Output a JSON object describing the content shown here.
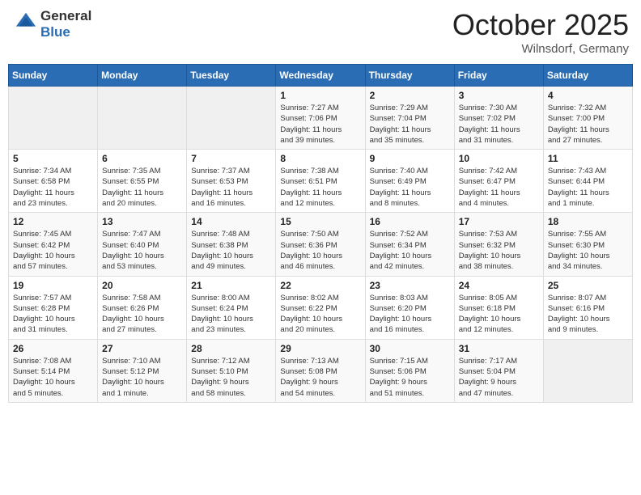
{
  "header": {
    "logo_line1": "General",
    "logo_line2": "Blue",
    "month_title": "October 2025",
    "location": "Wilnsdorf, Germany"
  },
  "days_of_week": [
    "Sunday",
    "Monday",
    "Tuesday",
    "Wednesday",
    "Thursday",
    "Friday",
    "Saturday"
  ],
  "weeks": [
    [
      {
        "day": "",
        "info": ""
      },
      {
        "day": "",
        "info": ""
      },
      {
        "day": "",
        "info": ""
      },
      {
        "day": "1",
        "info": "Sunrise: 7:27 AM\nSunset: 7:06 PM\nDaylight: 11 hours\nand 39 minutes."
      },
      {
        "day": "2",
        "info": "Sunrise: 7:29 AM\nSunset: 7:04 PM\nDaylight: 11 hours\nand 35 minutes."
      },
      {
        "day": "3",
        "info": "Sunrise: 7:30 AM\nSunset: 7:02 PM\nDaylight: 11 hours\nand 31 minutes."
      },
      {
        "day": "4",
        "info": "Sunrise: 7:32 AM\nSunset: 7:00 PM\nDaylight: 11 hours\nand 27 minutes."
      }
    ],
    [
      {
        "day": "5",
        "info": "Sunrise: 7:34 AM\nSunset: 6:58 PM\nDaylight: 11 hours\nand 23 minutes."
      },
      {
        "day": "6",
        "info": "Sunrise: 7:35 AM\nSunset: 6:55 PM\nDaylight: 11 hours\nand 20 minutes."
      },
      {
        "day": "7",
        "info": "Sunrise: 7:37 AM\nSunset: 6:53 PM\nDaylight: 11 hours\nand 16 minutes."
      },
      {
        "day": "8",
        "info": "Sunrise: 7:38 AM\nSunset: 6:51 PM\nDaylight: 11 hours\nand 12 minutes."
      },
      {
        "day": "9",
        "info": "Sunrise: 7:40 AM\nSunset: 6:49 PM\nDaylight: 11 hours\nand 8 minutes."
      },
      {
        "day": "10",
        "info": "Sunrise: 7:42 AM\nSunset: 6:47 PM\nDaylight: 11 hours\nand 4 minutes."
      },
      {
        "day": "11",
        "info": "Sunrise: 7:43 AM\nSunset: 6:44 PM\nDaylight: 11 hours\nand 1 minute."
      }
    ],
    [
      {
        "day": "12",
        "info": "Sunrise: 7:45 AM\nSunset: 6:42 PM\nDaylight: 10 hours\nand 57 minutes."
      },
      {
        "day": "13",
        "info": "Sunrise: 7:47 AM\nSunset: 6:40 PM\nDaylight: 10 hours\nand 53 minutes."
      },
      {
        "day": "14",
        "info": "Sunrise: 7:48 AM\nSunset: 6:38 PM\nDaylight: 10 hours\nand 49 minutes."
      },
      {
        "day": "15",
        "info": "Sunrise: 7:50 AM\nSunset: 6:36 PM\nDaylight: 10 hours\nand 46 minutes."
      },
      {
        "day": "16",
        "info": "Sunrise: 7:52 AM\nSunset: 6:34 PM\nDaylight: 10 hours\nand 42 minutes."
      },
      {
        "day": "17",
        "info": "Sunrise: 7:53 AM\nSunset: 6:32 PM\nDaylight: 10 hours\nand 38 minutes."
      },
      {
        "day": "18",
        "info": "Sunrise: 7:55 AM\nSunset: 6:30 PM\nDaylight: 10 hours\nand 34 minutes."
      }
    ],
    [
      {
        "day": "19",
        "info": "Sunrise: 7:57 AM\nSunset: 6:28 PM\nDaylight: 10 hours\nand 31 minutes."
      },
      {
        "day": "20",
        "info": "Sunrise: 7:58 AM\nSunset: 6:26 PM\nDaylight: 10 hours\nand 27 minutes."
      },
      {
        "day": "21",
        "info": "Sunrise: 8:00 AM\nSunset: 6:24 PM\nDaylight: 10 hours\nand 23 minutes."
      },
      {
        "day": "22",
        "info": "Sunrise: 8:02 AM\nSunset: 6:22 PM\nDaylight: 10 hours\nand 20 minutes."
      },
      {
        "day": "23",
        "info": "Sunrise: 8:03 AM\nSunset: 6:20 PM\nDaylight: 10 hours\nand 16 minutes."
      },
      {
        "day": "24",
        "info": "Sunrise: 8:05 AM\nSunset: 6:18 PM\nDaylight: 10 hours\nand 12 minutes."
      },
      {
        "day": "25",
        "info": "Sunrise: 8:07 AM\nSunset: 6:16 PM\nDaylight: 10 hours\nand 9 minutes."
      }
    ],
    [
      {
        "day": "26",
        "info": "Sunrise: 7:08 AM\nSunset: 5:14 PM\nDaylight: 10 hours\nand 5 minutes."
      },
      {
        "day": "27",
        "info": "Sunrise: 7:10 AM\nSunset: 5:12 PM\nDaylight: 10 hours\nand 1 minute."
      },
      {
        "day": "28",
        "info": "Sunrise: 7:12 AM\nSunset: 5:10 PM\nDaylight: 9 hours\nand 58 minutes."
      },
      {
        "day": "29",
        "info": "Sunrise: 7:13 AM\nSunset: 5:08 PM\nDaylight: 9 hours\nand 54 minutes."
      },
      {
        "day": "30",
        "info": "Sunrise: 7:15 AM\nSunset: 5:06 PM\nDaylight: 9 hours\nand 51 minutes."
      },
      {
        "day": "31",
        "info": "Sunrise: 7:17 AM\nSunset: 5:04 PM\nDaylight: 9 hours\nand 47 minutes."
      },
      {
        "day": "",
        "info": ""
      }
    ]
  ]
}
